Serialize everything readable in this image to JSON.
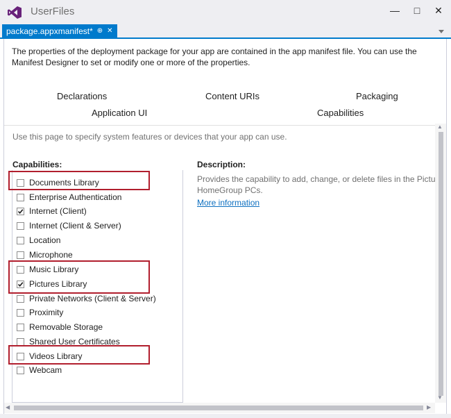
{
  "window": {
    "title": "UserFiles",
    "minimize_glyph": "—",
    "maximize_glyph": "□",
    "close_glyph": "✕"
  },
  "tab": {
    "label": "package.appxmanifest*",
    "pin_glyph": "⊕",
    "close_glyph": "✕"
  },
  "intro_text": "The properties of the deployment package for your app are contained in the app manifest file. You can use the Manifest Designer to set or modify one or more of the properties.",
  "manifest_tabs": [
    "Declarations",
    "Content URIs",
    "Packaging",
    "Application UI",
    "Capabilities"
  ],
  "page_description": "Use this page to specify system features or devices that your app can use.",
  "capabilities": {
    "heading": "Capabilities:",
    "items": [
      {
        "label": "Documents Library",
        "checked": false
      },
      {
        "label": "Enterprise Authentication",
        "checked": false
      },
      {
        "label": "Internet (Client)",
        "checked": true
      },
      {
        "label": "Internet (Client & Server)",
        "checked": false
      },
      {
        "label": "Location",
        "checked": false
      },
      {
        "label": "Microphone",
        "checked": false
      },
      {
        "label": "Music Library",
        "checked": false
      },
      {
        "label": "Pictures Library",
        "checked": true
      },
      {
        "label": "Private Networks (Client & Server)",
        "checked": false
      },
      {
        "label": "Proximity",
        "checked": false
      },
      {
        "label": "Removable Storage",
        "checked": false
      },
      {
        "label": "Shared User Certificates",
        "checked": false
      },
      {
        "label": "Videos Library",
        "checked": false
      },
      {
        "label": "Webcam",
        "checked": false
      }
    ]
  },
  "description": {
    "heading": "Description:",
    "lines": [
      "Provides the capability to add, change, or delete files in the Pictures",
      "HomeGroup PCs."
    ],
    "link": "More information"
  },
  "colors": {
    "accent": "#007acc",
    "highlight_box": "#b11e2d",
    "link": "#0e70c0"
  },
  "icons": {
    "logo": "visual-studio-logo",
    "check": "checkmark-icon"
  }
}
